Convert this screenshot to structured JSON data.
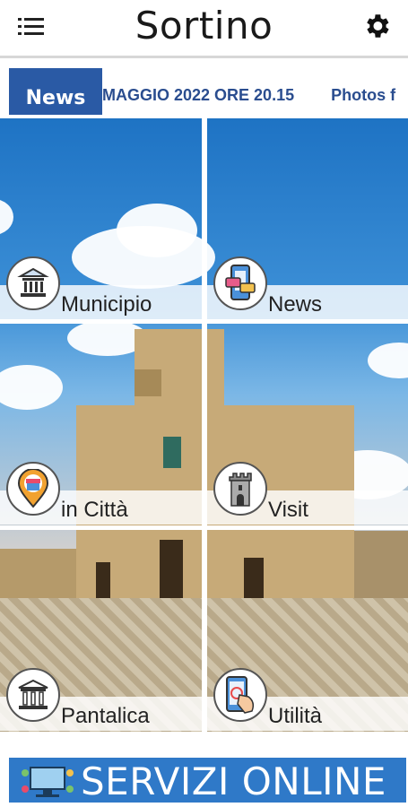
{
  "app": {
    "title": "Sortino"
  },
  "icons": {
    "menu": "menu-icon",
    "settings": "gear-icon"
  },
  "ticker": {
    "badge": "News",
    "items": [
      "MAGGIO 2022 ORE 20.15",
      "Photos f"
    ]
  },
  "tiles": [
    {
      "label": "Municipio",
      "icon": "town-hall-icon"
    },
    {
      "label": "News",
      "icon": "mobile-news-icon"
    },
    {
      "label": "in Città",
      "icon": "map-pin-shop-icon"
    },
    {
      "label": "Visit",
      "icon": "tower-icon"
    },
    {
      "label": "Pantalica",
      "icon": "temple-icon"
    },
    {
      "label": "Utilità",
      "icon": "touch-phone-icon"
    }
  ],
  "services": {
    "label": "SERVIZI ONLINE",
    "icon": "online-services-icon"
  },
  "colors": {
    "accent": "#2a5aa5",
    "banner": "#2f79c8"
  }
}
